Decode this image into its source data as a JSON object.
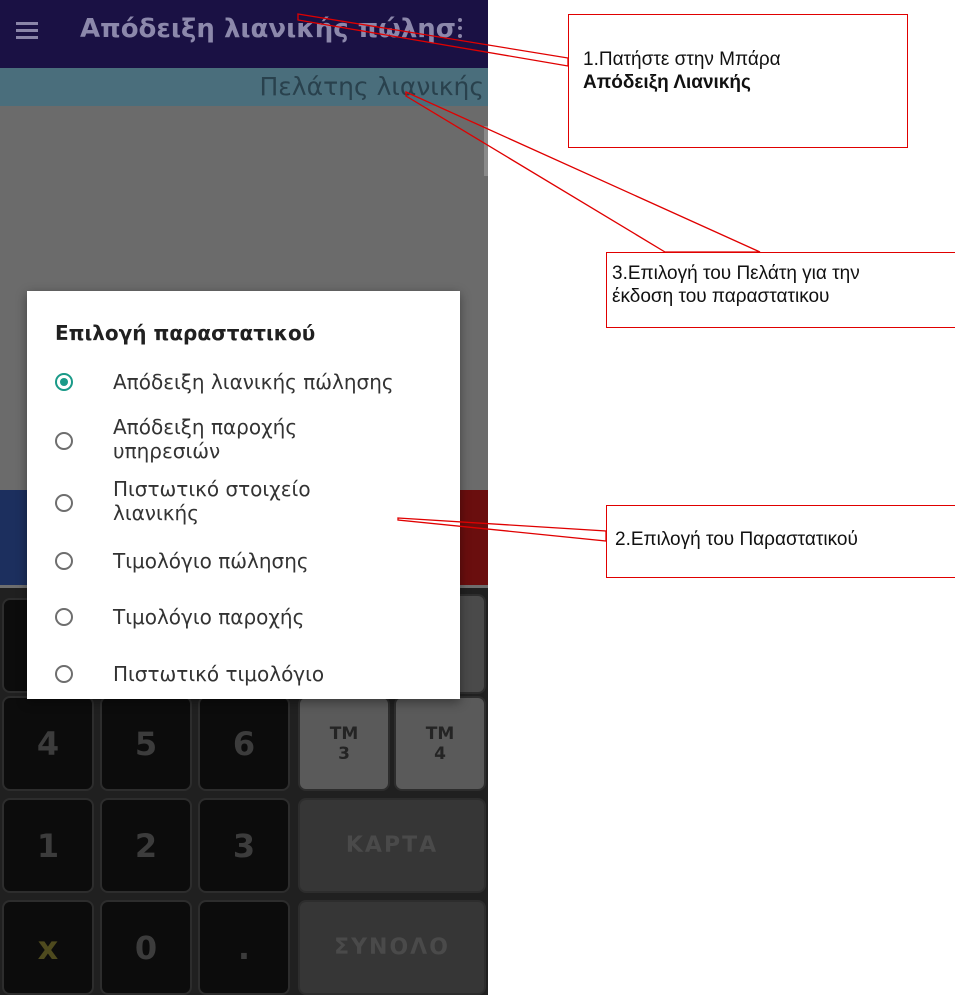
{
  "app": {
    "title": "Απόδειξη λιανικής πώλησ",
    "customer": "Πελάτης λιανικής",
    "menu_icon": "hamburger-icon",
    "overflow_icon": "more-vert-icon"
  },
  "dialog": {
    "title": "Επιλογή παραστατικού",
    "selected_index": 0,
    "options": [
      "Απόδειξη λιανικής πώλησης",
      "Απόδειξη παροχής υπηρεσιών",
      "Πιστωτικό στοιχείο λιανικής",
      "Τιμολόγιο πώλησης",
      "Τιμολόγιο παροχής",
      "Πιστωτικό τιμολόγιο"
    ]
  },
  "keypad": {
    "row1": [
      "4",
      "5",
      "6",
      "ΤΜ 3",
      "ΤΜ 4"
    ],
    "tm3_top": "ΤΜ",
    "tm3_bottom": "3",
    "tm4_top": "ΤΜ",
    "tm4_bottom": "4",
    "row2": [
      "1",
      "2",
      "3"
    ],
    "card": "ΚΑΡΤΑ",
    "row3": [
      "x",
      "0",
      "."
    ],
    "total": "ΣΥΝΟΛΟ"
  },
  "annotations": {
    "note1_line1": "1.Πατήστε στην Μπάρα",
    "note1_line2": "Απόδειξη Λιανικής",
    "note2": "2.Επιλογή του Παραστατικού",
    "note3_line1": "3.Επιλογή του Πελάτη για την",
    "note3_line2": "έκδοση του παραστατικου",
    "color": "#e00000"
  },
  "colors": {
    "accent": "#1a9a88",
    "appbar": "#311f7c"
  }
}
